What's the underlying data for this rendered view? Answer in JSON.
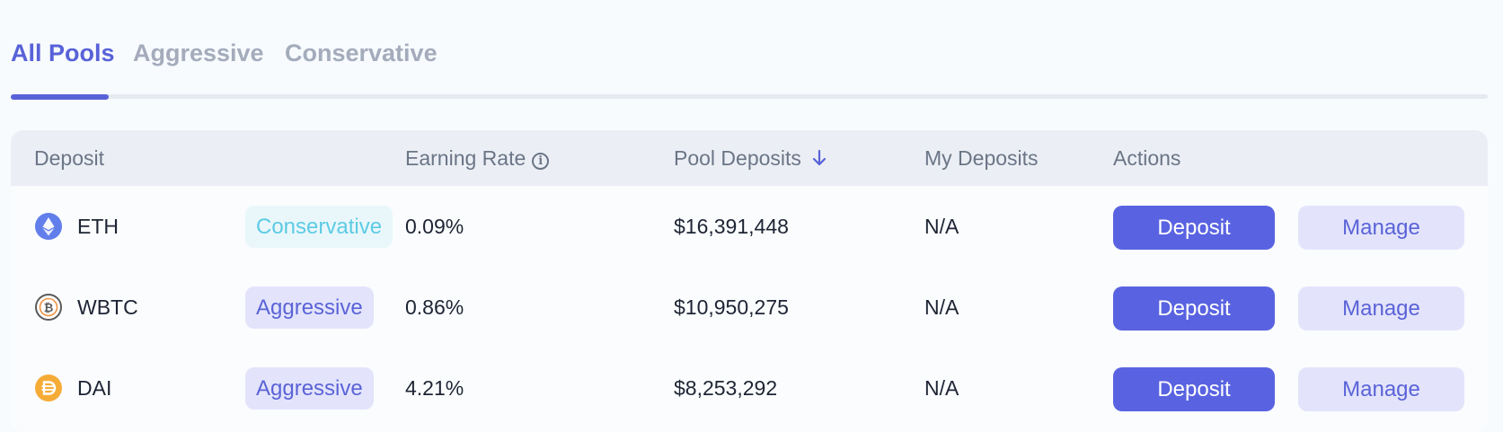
{
  "tabs": [
    {
      "label": "All Pools",
      "active": true
    },
    {
      "label": "Aggressive",
      "active": false
    },
    {
      "label": "Conservative",
      "active": false
    }
  ],
  "table": {
    "headers": {
      "deposit": "Deposit",
      "earning_rate": "Earning Rate",
      "pool_deposits": "Pool Deposits",
      "my_deposits": "My Deposits",
      "actions": "Actions"
    },
    "sort": {
      "column": "pool_deposits",
      "direction": "desc"
    },
    "rows": [
      {
        "coin": "ETH",
        "icon": "eth-icon",
        "strategy": "Conservative",
        "earning_rate": "0.09%",
        "pool_deposits": "$16,391,448",
        "my_deposits": "N/A",
        "deposit_label": "Deposit",
        "manage_label": "Manage"
      },
      {
        "coin": "WBTC",
        "icon": "wbtc-icon",
        "strategy": "Aggressive",
        "earning_rate": "0.86%",
        "pool_deposits": "$10,950,275",
        "my_deposits": "N/A",
        "deposit_label": "Deposit",
        "manage_label": "Manage"
      },
      {
        "coin": "DAI",
        "icon": "dai-icon",
        "strategy": "Aggressive",
        "earning_rate": "4.21%",
        "pool_deposits": "$8,253,292",
        "my_deposits": "N/A",
        "deposit_label": "Deposit",
        "manage_label": "Manage"
      }
    ]
  },
  "colors": {
    "accent": "#5862d8",
    "deposit_button": "#5963e1",
    "conservative_badge_text": "#5dcbe3",
    "aggressive_badge_text": "#5a63d7"
  }
}
